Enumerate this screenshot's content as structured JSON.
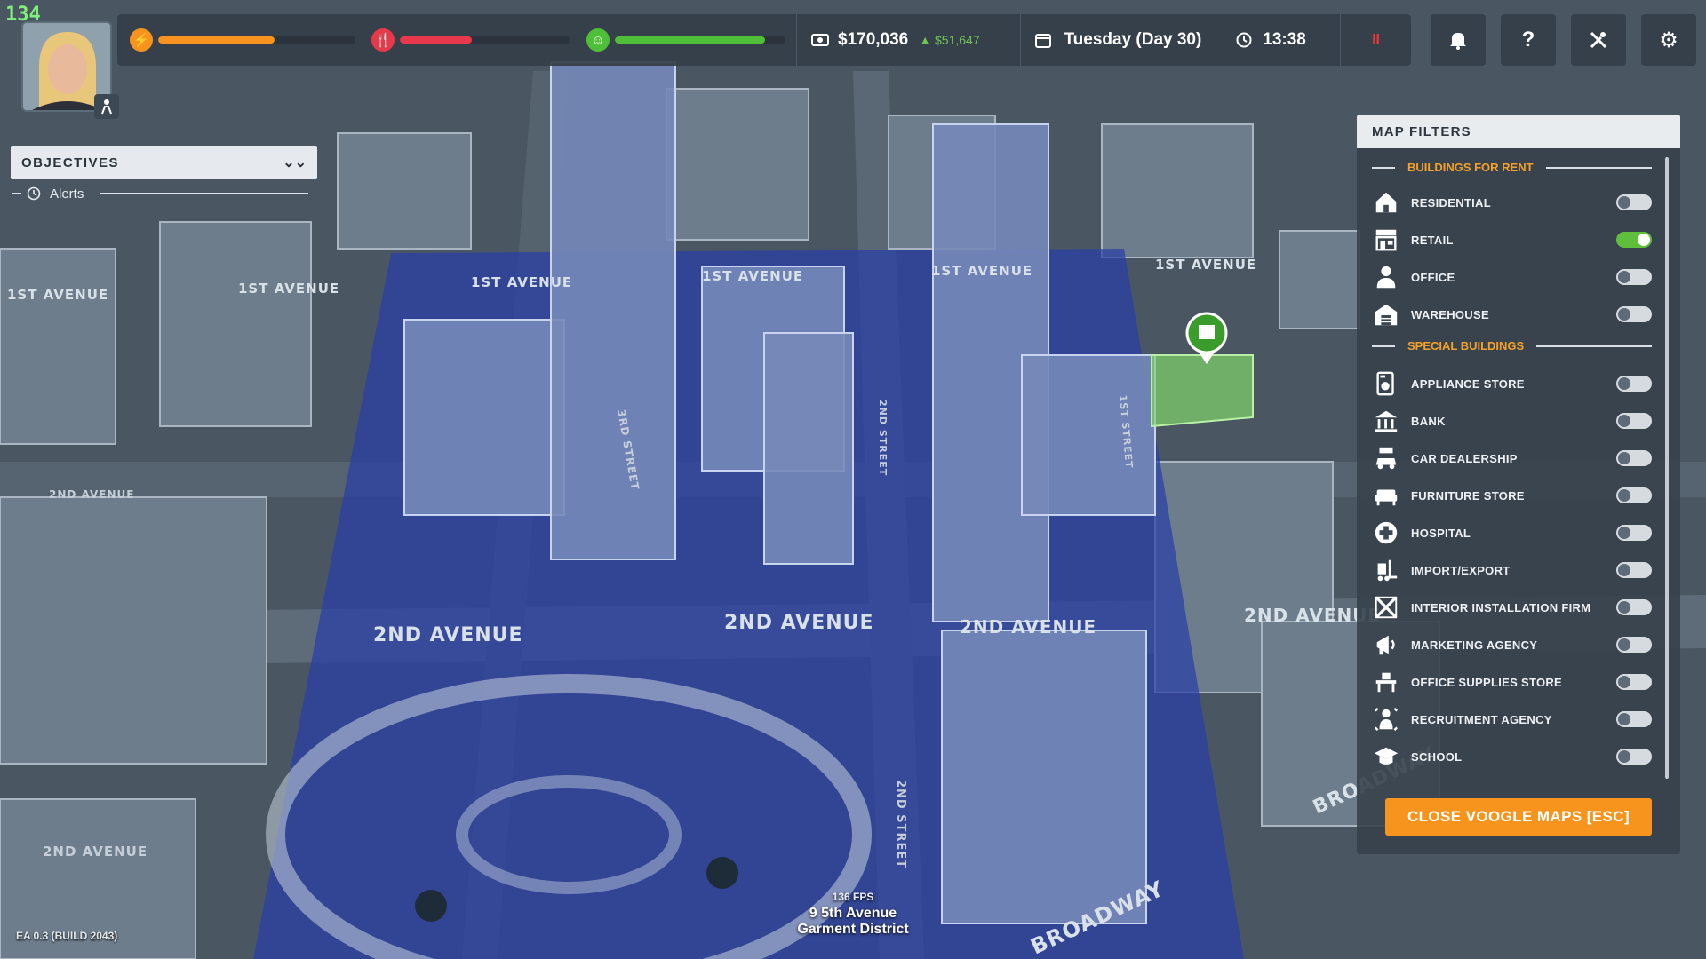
{
  "fps_counter": "134",
  "topbar": {
    "energy_level": 0.59,
    "hunger_level": 0.42,
    "happiness_level": 0.88,
    "money": "$170,036",
    "money_delta": "$51,647",
    "date": "Tuesday (Day 30)",
    "time": "13:38",
    "pause_label": "II"
  },
  "objectives": {
    "title": "OBJECTIVES",
    "alerts_label": "Alerts"
  },
  "map_filters": {
    "title": "MAP FILTERS",
    "section_rent": "BUILDINGS FOR RENT",
    "rent_items": [
      {
        "label": "RESIDENTIAL",
        "icon": "house-icon",
        "on": false
      },
      {
        "label": "RETAIL",
        "icon": "shop-icon",
        "on": true
      },
      {
        "label": "OFFICE",
        "icon": "office-worker-icon",
        "on": false
      },
      {
        "label": "WAREHOUSE",
        "icon": "warehouse-icon",
        "on": false
      }
    ],
    "section_special": "SPECIAL BUILDINGS",
    "special_items": [
      {
        "label": "APPLIANCE STORE",
        "icon": "appliance-icon",
        "on": false
      },
      {
        "label": "BANK",
        "icon": "bank-icon",
        "on": false
      },
      {
        "label": "CAR DEALERSHIP",
        "icon": "car-sale-icon",
        "on": false
      },
      {
        "label": "FURNITURE STORE",
        "icon": "sofa-icon",
        "on": false
      },
      {
        "label": "HOSPITAL",
        "icon": "medical-cross-icon",
        "on": false
      },
      {
        "label": "IMPORT/EXPORT",
        "icon": "forklift-icon",
        "on": false
      },
      {
        "label": "INTERIOR INSTALLATION FIRM",
        "icon": "tools-icon",
        "on": false
      },
      {
        "label": "MARKETING AGENCY",
        "icon": "megaphone-icon",
        "on": false
      },
      {
        "label": "OFFICE SUPPLIES STORE",
        "icon": "desk-icon",
        "on": false
      },
      {
        "label": "RECRUITMENT AGENCY",
        "icon": "recruit-icon",
        "on": false
      },
      {
        "label": "SCHOOL",
        "icon": "graduation-cap-icon",
        "on": false
      }
    ],
    "close_button": "CLOSE VOOGLE MAPS [ESC]"
  },
  "streets": {
    "first_ave": "1ST AVENUE",
    "second_ave": "2ND AVENUE",
    "second_st": "2ND STREET",
    "third_st": "3RD STREET",
    "first_st": "1ST STREET",
    "broadway": "BROADWAY"
  },
  "bottom": {
    "fps": "136 FPS",
    "address": "9 5th Avenue",
    "district": "Garment District",
    "build": "EA 0.3 (BUILD 2043)"
  },
  "colors": {
    "selection_blue": "#2a3ea8",
    "accent_orange": "#f7941d",
    "toggle_on": "#5fbf3a",
    "energy": "#f7931e",
    "hunger": "#e8394a",
    "happiness": "#4fbf3a"
  }
}
